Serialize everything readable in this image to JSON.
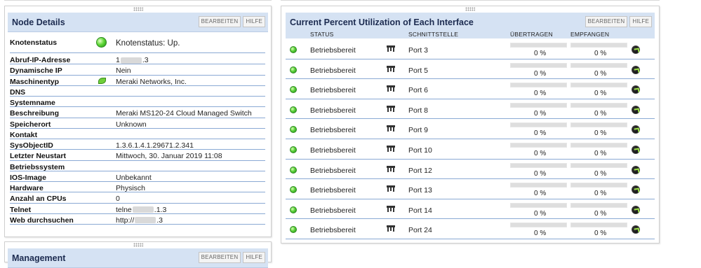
{
  "node_details": {
    "title": "Node Details",
    "edit_label": "BEARBEITEN",
    "help_label": "HILFE",
    "status_label": "Knotenstatus",
    "status_value": "Knotenstatus: Up.",
    "rows": [
      {
        "label": "Abruf-IP-Adresse",
        "value": "1",
        "suffix": ".3"
      },
      {
        "label": "Dynamische IP",
        "value": "Nein"
      },
      {
        "label": "Maschinentyp",
        "value": "Meraki Networks, Inc."
      },
      {
        "label": "DNS",
        "value": ""
      },
      {
        "label": "Systemname",
        "value": ""
      },
      {
        "label": "Beschreibung",
        "value": "Meraki MS120-24 Cloud Managed Switch"
      },
      {
        "label": "Speicherort",
        "value": "Unknown"
      },
      {
        "label": "Kontakt",
        "value": ""
      },
      {
        "label": "SysObjectID",
        "value": "1.3.6.1.4.1.29671.2.341"
      },
      {
        "label": "Letzter Neustart",
        "value": "Mittwoch, 30. Januar 2019 11:08"
      },
      {
        "label": "Betriebssystem",
        "value": ""
      },
      {
        "label": "IOS-Image",
        "value": "Unbekannt"
      },
      {
        "label": "Hardware",
        "value": "Physisch"
      },
      {
        "label": "Anzahl an CPUs",
        "value": "0"
      },
      {
        "label": "Telnet",
        "value": "telne",
        "suffix": ".1.3"
      },
      {
        "label": "Web durchsuchen",
        "value": "http://",
        "suffix": ".3"
      }
    ]
  },
  "management": {
    "title": "Management",
    "edit_label": "BEARBEITEN",
    "help_label": "HILFE"
  },
  "interfaces": {
    "title": "Current Percent Utilization of Each Interface",
    "edit_label": "BEARBEITEN",
    "help_label": "HILFE",
    "columns": {
      "status": "STATUS",
      "interface": "SCHNITTSTELLE",
      "transmit": "ÜBERTRAGEN",
      "receive": "EMPFANGEN"
    },
    "rows": [
      {
        "status": "Betriebsbereit",
        "port": "Port 3",
        "tx": "0 %",
        "rx": "0 %",
        "tx_fraction": 0,
        "rx_fraction": 0
      },
      {
        "status": "Betriebsbereit",
        "port": "Port 5",
        "tx": "0 %",
        "rx": "0 %",
        "tx_fraction": 0,
        "rx_fraction": 0
      },
      {
        "status": "Betriebsbereit",
        "port": "Port 6",
        "tx": "0 %",
        "rx": "0 %",
        "tx_fraction": 0,
        "rx_fraction": 0
      },
      {
        "status": "Betriebsbereit",
        "port": "Port 8",
        "tx": "0 %",
        "rx": "0 %",
        "tx_fraction": 0,
        "rx_fraction": 0
      },
      {
        "status": "Betriebsbereit",
        "port": "Port 9",
        "tx": "0 %",
        "rx": "0 %",
        "tx_fraction": 0,
        "rx_fraction": 0
      },
      {
        "status": "Betriebsbereit",
        "port": "Port 10",
        "tx": "0 %",
        "rx": "0 %",
        "tx_fraction": 0,
        "rx_fraction": 0
      },
      {
        "status": "Betriebsbereit",
        "port": "Port 12",
        "tx": "0 %",
        "rx": "0 %",
        "tx_fraction": 0,
        "rx_fraction": 0
      },
      {
        "status": "Betriebsbereit",
        "port": "Port 13",
        "tx": "0 %",
        "rx": "0 %",
        "tx_fraction": 0,
        "rx_fraction": 0
      },
      {
        "status": "Betriebsbereit",
        "port": "Port 14",
        "tx": "0 %",
        "rx": "0 %",
        "tx_fraction": 0,
        "rx_fraction": 0
      },
      {
        "status": "Betriebsbereit",
        "port": "Port 24",
        "tx": "0 %",
        "rx": "0 %",
        "tx_fraction": 0,
        "rx_fraction": 0
      }
    ]
  },
  "colors": {
    "header_bg": "#d5e2f3",
    "row_divider": "#8aa9d4",
    "status_up": "#5bd13a"
  },
  "icons": {
    "status": "status-up-icon",
    "interface": "network-port-icon",
    "detail": "interface-detail-icon"
  }
}
